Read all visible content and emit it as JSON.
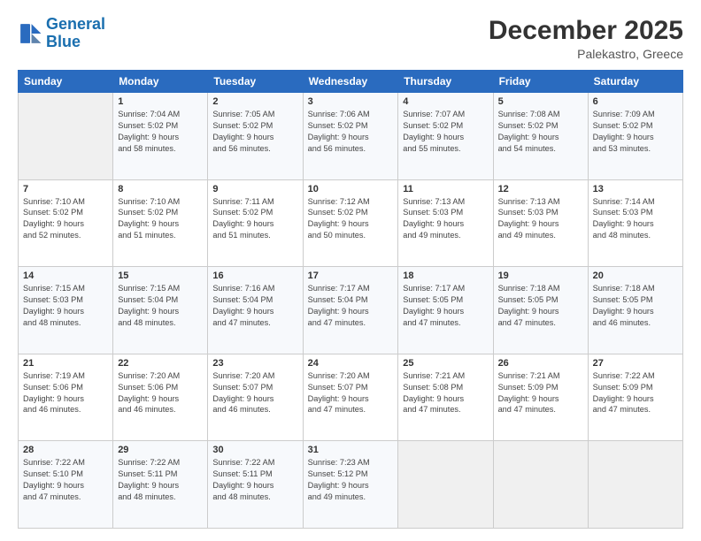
{
  "logo": {
    "line1": "General",
    "line2": "Blue"
  },
  "header": {
    "title": "December 2025",
    "subtitle": "Palekastro, Greece"
  },
  "calendar": {
    "days_of_week": [
      "Sunday",
      "Monday",
      "Tuesday",
      "Wednesday",
      "Thursday",
      "Friday",
      "Saturday"
    ],
    "weeks": [
      [
        {
          "day": "",
          "info": ""
        },
        {
          "day": "1",
          "info": "Sunrise: 7:04 AM\nSunset: 5:02 PM\nDaylight: 9 hours\nand 58 minutes."
        },
        {
          "day": "2",
          "info": "Sunrise: 7:05 AM\nSunset: 5:02 PM\nDaylight: 9 hours\nand 56 minutes."
        },
        {
          "day": "3",
          "info": "Sunrise: 7:06 AM\nSunset: 5:02 PM\nDaylight: 9 hours\nand 56 minutes."
        },
        {
          "day": "4",
          "info": "Sunrise: 7:07 AM\nSunset: 5:02 PM\nDaylight: 9 hours\nand 55 minutes."
        },
        {
          "day": "5",
          "info": "Sunrise: 7:08 AM\nSunset: 5:02 PM\nDaylight: 9 hours\nand 54 minutes."
        },
        {
          "day": "6",
          "info": "Sunrise: 7:09 AM\nSunset: 5:02 PM\nDaylight: 9 hours\nand 53 minutes."
        }
      ],
      [
        {
          "day": "7",
          "info": "Sunrise: 7:10 AM\nSunset: 5:02 PM\nDaylight: 9 hours\nand 52 minutes."
        },
        {
          "day": "8",
          "info": "Sunrise: 7:10 AM\nSunset: 5:02 PM\nDaylight: 9 hours\nand 51 minutes."
        },
        {
          "day": "9",
          "info": "Sunrise: 7:11 AM\nSunset: 5:02 PM\nDaylight: 9 hours\nand 51 minutes."
        },
        {
          "day": "10",
          "info": "Sunrise: 7:12 AM\nSunset: 5:02 PM\nDaylight: 9 hours\nand 50 minutes."
        },
        {
          "day": "11",
          "info": "Sunrise: 7:13 AM\nSunset: 5:03 PM\nDaylight: 9 hours\nand 49 minutes."
        },
        {
          "day": "12",
          "info": "Sunrise: 7:13 AM\nSunset: 5:03 PM\nDaylight: 9 hours\nand 49 minutes."
        },
        {
          "day": "13",
          "info": "Sunrise: 7:14 AM\nSunset: 5:03 PM\nDaylight: 9 hours\nand 48 minutes."
        }
      ],
      [
        {
          "day": "14",
          "info": "Sunrise: 7:15 AM\nSunset: 5:03 PM\nDaylight: 9 hours\nand 48 minutes."
        },
        {
          "day": "15",
          "info": "Sunrise: 7:15 AM\nSunset: 5:04 PM\nDaylight: 9 hours\nand 48 minutes."
        },
        {
          "day": "16",
          "info": "Sunrise: 7:16 AM\nSunset: 5:04 PM\nDaylight: 9 hours\nand 47 minutes."
        },
        {
          "day": "17",
          "info": "Sunrise: 7:17 AM\nSunset: 5:04 PM\nDaylight: 9 hours\nand 47 minutes."
        },
        {
          "day": "18",
          "info": "Sunrise: 7:17 AM\nSunset: 5:05 PM\nDaylight: 9 hours\nand 47 minutes."
        },
        {
          "day": "19",
          "info": "Sunrise: 7:18 AM\nSunset: 5:05 PM\nDaylight: 9 hours\nand 47 minutes."
        },
        {
          "day": "20",
          "info": "Sunrise: 7:18 AM\nSunset: 5:05 PM\nDaylight: 9 hours\nand 46 minutes."
        }
      ],
      [
        {
          "day": "21",
          "info": "Sunrise: 7:19 AM\nSunset: 5:06 PM\nDaylight: 9 hours\nand 46 minutes."
        },
        {
          "day": "22",
          "info": "Sunrise: 7:20 AM\nSunset: 5:06 PM\nDaylight: 9 hours\nand 46 minutes."
        },
        {
          "day": "23",
          "info": "Sunrise: 7:20 AM\nSunset: 5:07 PM\nDaylight: 9 hours\nand 46 minutes."
        },
        {
          "day": "24",
          "info": "Sunrise: 7:20 AM\nSunset: 5:07 PM\nDaylight: 9 hours\nand 47 minutes."
        },
        {
          "day": "25",
          "info": "Sunrise: 7:21 AM\nSunset: 5:08 PM\nDaylight: 9 hours\nand 47 minutes."
        },
        {
          "day": "26",
          "info": "Sunrise: 7:21 AM\nSunset: 5:09 PM\nDaylight: 9 hours\nand 47 minutes."
        },
        {
          "day": "27",
          "info": "Sunrise: 7:22 AM\nSunset: 5:09 PM\nDaylight: 9 hours\nand 47 minutes."
        }
      ],
      [
        {
          "day": "28",
          "info": "Sunrise: 7:22 AM\nSunset: 5:10 PM\nDaylight: 9 hours\nand 47 minutes."
        },
        {
          "day": "29",
          "info": "Sunrise: 7:22 AM\nSunset: 5:11 PM\nDaylight: 9 hours\nand 48 minutes."
        },
        {
          "day": "30",
          "info": "Sunrise: 7:22 AM\nSunset: 5:11 PM\nDaylight: 9 hours\nand 48 minutes."
        },
        {
          "day": "31",
          "info": "Sunrise: 7:23 AM\nSunset: 5:12 PM\nDaylight: 9 hours\nand 49 minutes."
        },
        {
          "day": "",
          "info": ""
        },
        {
          "day": "",
          "info": ""
        },
        {
          "day": "",
          "info": ""
        }
      ]
    ]
  }
}
